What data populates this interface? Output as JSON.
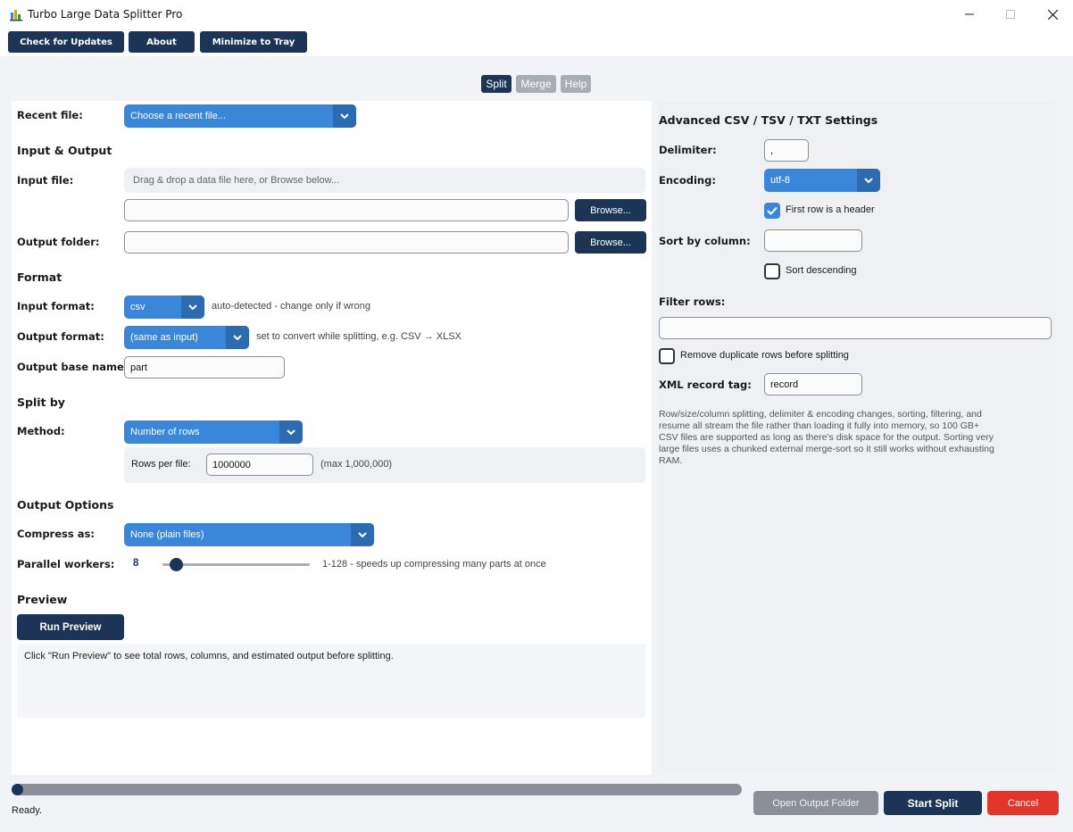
{
  "window": {
    "title": "Turbo Large Data Splitter Pro"
  },
  "toolbar": {
    "check_updates": "Check for Updates",
    "about": "About",
    "minimize_tray": "Minimize to Tray"
  },
  "tabs": {
    "split": "Split",
    "merge": "Merge",
    "help": "Help"
  },
  "left": {
    "recent_label": "Recent file:",
    "recent_value": "Choose a recent file...",
    "io_heading": "Input & Output",
    "input_label": "Input file:",
    "dropzone": "Drag & drop a data file here, or Browse below...",
    "input_value": "",
    "browse1": "Browse...",
    "output_label": "Output folder:",
    "output_value": "",
    "browse2": "Browse...",
    "format_heading": "Format",
    "in_format_label": "Input format:",
    "in_format_value": "csv",
    "in_format_hint": "auto-detected - change only if wrong",
    "out_format_label": "Output format:",
    "out_format_value": "(same as input)",
    "out_format_hint": "set to convert while splitting, e.g. CSV → XLSX",
    "base_label": "Output base name:",
    "base_value": "part",
    "splitby_heading": "Split by",
    "method_label": "Method:",
    "method_value": "Number of rows",
    "rows_label": "Rows per file:",
    "rows_value": "1000000",
    "rows_hint": "(max 1,000,000)",
    "outopts_heading": "Output Options",
    "compress_label": "Compress as:",
    "compress_value": "None (plain files)",
    "workers_label": "Parallel workers:",
    "workers_value": "8",
    "workers_hint": "1-128 - speeds up compressing many parts at once",
    "workers_fraction": 0.05,
    "preview_heading": "Preview",
    "run_preview": "Run Preview",
    "preview_text": "Click \"Run Preview\" to see total rows, columns, and estimated output before splitting."
  },
  "right": {
    "heading": "Advanced CSV / TSV / TXT Settings",
    "delimiter_label": "Delimiter:",
    "delimiter_value": ",",
    "encoding_label": "Encoding:",
    "encoding_value": "utf-8",
    "header_check": "First row is a header",
    "sort_label": "Sort by column:",
    "sort_value": "",
    "sort_desc": "Sort descending",
    "filter_label": "Filter rows:",
    "filter_value": "",
    "dedupe": "Remove duplicate rows before splitting",
    "xml_label": "XML record tag:",
    "xml_value": "record",
    "info": "Row/size/column splitting, delimiter & encoding changes, sorting, filtering, and resume all stream the file rather than loading it fully into memory, so 100 GB+ CSV files are supported as long as there's disk space for the output. Sorting very large files uses a chunked external merge-sort so it still works without exhausting RAM."
  },
  "footer": {
    "progress": 0.0,
    "status": "Ready.",
    "open_folder": "Open Output Folder",
    "start": "Start Split",
    "cancel": "Cancel"
  },
  "colors": {
    "navy": "#1c3557",
    "blue": "#3a86d9",
    "red": "#e0362c",
    "gray": "#8a8f98"
  }
}
